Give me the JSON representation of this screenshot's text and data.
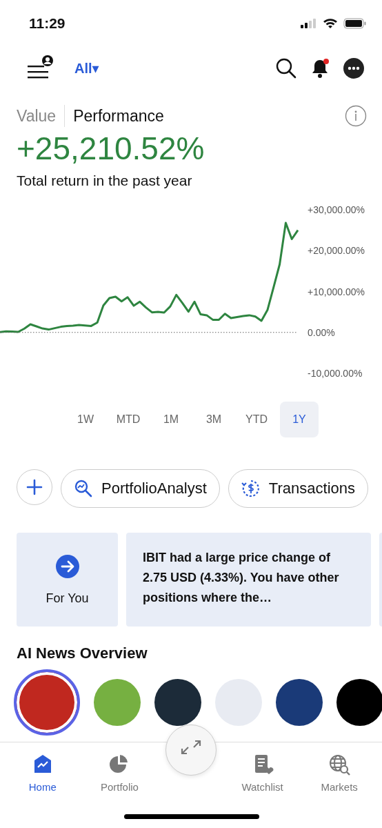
{
  "status_bar": {
    "time": "11:29"
  },
  "header": {
    "account_filter": "All▾"
  },
  "view_tabs": [
    {
      "label": "Value",
      "selected": false
    },
    {
      "label": "Performance",
      "selected": true
    }
  ],
  "summary": {
    "value": "+25,210.52%",
    "caption": "Total return in the past year"
  },
  "chart_data": {
    "type": "line",
    "series": [
      {
        "color": "#2e8540",
        "values": [
          100,
          270,
          220,
          120,
          940,
          1990,
          1470,
          950,
          700,
          1030,
          1370,
          1560,
          1670,
          1790,
          1700,
          1580,
          2400,
          6570,
          8400,
          8730,
          7600,
          8600,
          6520,
          7510,
          6080,
          4900,
          5000,
          4850,
          6360,
          9180,
          7200,
          5080,
          7500,
          4420,
          4200,
          3100,
          3080,
          4570,
          3500,
          3750,
          4000,
          4190,
          3870,
          2850,
          5470,
          11000,
          16670,
          26800,
          22830,
          25000
        ]
      }
    ],
    "ylim": [
      -10000,
      30000
    ],
    "yticks": [
      {
        "value": 30000,
        "label": "+30,000.00%"
      },
      {
        "value": 20000,
        "label": "+20,000.00%"
      },
      {
        "value": 10000,
        "label": "+10,000.00%"
      },
      {
        "value": 0,
        "label": "0.00%"
      },
      {
        "value": -10000,
        "label": "-10,000.00%"
      }
    ]
  },
  "ranges": [
    {
      "label": "1W",
      "selected": false
    },
    {
      "label": "MTD",
      "selected": false
    },
    {
      "label": "1M",
      "selected": false
    },
    {
      "label": "3M",
      "selected": false
    },
    {
      "label": "YTD",
      "selected": false
    },
    {
      "label": "1Y",
      "selected": true
    }
  ],
  "actions": [
    {
      "kind": "add"
    },
    {
      "kind": "analyst",
      "label": "PortfolioAnalyst"
    },
    {
      "kind": "transactions",
      "label": "Transactions"
    }
  ],
  "cards": [
    {
      "kind": "link",
      "label": "For You"
    },
    {
      "kind": "message",
      "text": "IBIT had a large price change of 2.75 USD (4.33%). You have other positions where the…"
    },
    {
      "kind": "blank"
    }
  ],
  "news": {
    "title": "AI News Overview",
    "items": [
      {
        "color": "#c0281f",
        "selected": true
      },
      {
        "color": "#76b041",
        "selected": false
      },
      {
        "color": "#1c2b39",
        "selected": false
      },
      {
        "color": "#e8ebf2",
        "selected": false
      },
      {
        "color": "#1a3a78",
        "selected": false
      },
      {
        "color": "#000000",
        "selected": false
      }
    ]
  },
  "nav": [
    {
      "kind": "home",
      "label": "Home",
      "selected": true
    },
    {
      "kind": "portfolio",
      "label": "Portfolio",
      "selected": false
    },
    {
      "kind": "center"
    },
    {
      "kind": "watchlist",
      "label": "Watchlist",
      "selected": false
    },
    {
      "kind": "markets",
      "label": "Markets",
      "selected": false
    }
  ]
}
